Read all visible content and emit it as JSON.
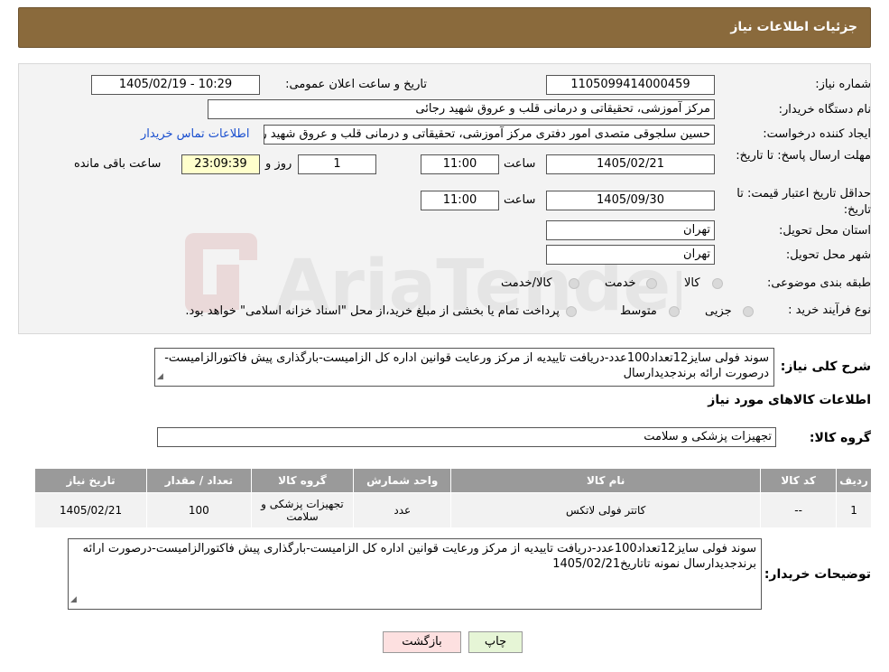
{
  "header": {
    "title": "جزئیات اطلاعات نیاز"
  },
  "form": {
    "need_number_label": "شماره نیاز:",
    "need_number": "1105099414000459",
    "announce_label": "تاریخ و ساعت اعلان عمومی:",
    "announce_value": "1405/02/19 - 10:29",
    "buyer_org_label": "نام دستگاه خریدار:",
    "buyer_org": "مرکز آموزشی، تحقیقاتی و درمانی قلب و عروق شهید رجائی",
    "requester_label": "ایجاد کننده درخواست:",
    "requester": "حسین سلجوقی متصدی امور دفتری مرکز آموزشی، تحقیقاتی و درمانی قلب و عروق شهید رجائی",
    "contact_link": "اطلاعات تماس خریدار",
    "deadline_label": "مهلت ارسال پاسخ: تا تاریخ:",
    "deadline_date": "1405/02/21",
    "time_label": "ساعت",
    "deadline_time": "11:00",
    "days_value": "1",
    "days_label": "روز و",
    "remaining_time": "23:09:39",
    "remaining_label": "ساعت باقی مانده",
    "validity_label": "حداقل تاریخ اعتبار قیمت: تا تاریخ:",
    "validity_date": "1405/09/30",
    "validity_time": "11:00",
    "province_label": "استان محل تحویل:",
    "province": "تهران",
    "city_label": "شهر محل تحویل:",
    "city": "تهران",
    "category_label": "طبقه بندی موضوعی:",
    "category_options": [
      "کالا",
      "خدمت",
      "کالا/خدمت"
    ],
    "process_label": "نوع فرآیند خرید :",
    "process_options": [
      "جزیی",
      "متوسط"
    ],
    "process_note": "پرداخت تمام یا بخشی از مبلغ خرید،از محل \"اسناد خزانه اسلامی\" خواهد بود."
  },
  "summary": {
    "label": "شرح کلی نیاز:",
    "text": "سوند فولی سایز12تعداد100عدد-دریافت تاییدیه از مرکز ورعایت قوانین اداره کل الزامیست-بارگذاری پیش فاکتورالزامیست-درصورت ارائه برندجدیدارسال"
  },
  "goods_section": {
    "title": "اطلاعات کالاهای مورد نیاز",
    "group_label": "گروه کالا:",
    "group_value": "تجهیزات پزشکی و سلامت"
  },
  "table": {
    "headers": [
      "ردیف",
      "کد کالا",
      "نام کالا",
      "واحد شمارش",
      "گروه کالا",
      "تعداد / مقدار",
      "تاریخ نیاز"
    ],
    "rows": [
      [
        "1",
        "--",
        "کاتتر فولی لاتکس",
        "عدد",
        "تجهیزات پزشکی و سلامت",
        "100",
        "1405/02/21"
      ]
    ]
  },
  "buyer_notes": {
    "label": "توضیحات خریدار:",
    "text": "سوند فولی سایز12تعداد100عدد-دریافت تاییدیه از مرکز ورعایت قوانین اداره کل الزامیست-بارگذاری پیش فاکتورالزامیست-درصورت ارائه برندجدیدارسال نمونه تاتاریخ1405/02/21"
  },
  "buttons": {
    "print": "چاپ",
    "back": "بازگشت"
  },
  "watermark": {
    "text": "AriaTender.neT"
  },
  "colors": {
    "header_bg": "#8a6a3c",
    "link": "#1a4fcf",
    "table_header": "#9a9a9a",
    "back_btn": "#fde0e0",
    "print_btn": "#e6f5d6"
  }
}
